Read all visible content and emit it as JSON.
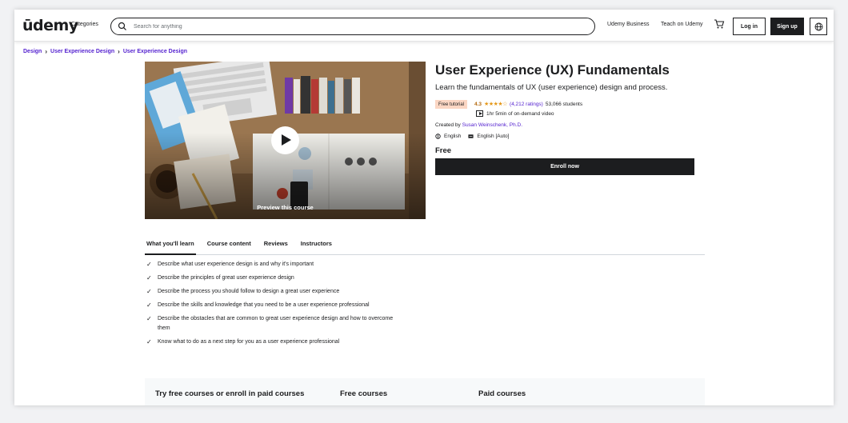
{
  "header": {
    "logo": "ūdemy",
    "categories_label": "Categories",
    "search_placeholder": "Search for anything",
    "business_label": "Udemy Business",
    "teach_label": "Teach on Udemy",
    "login_label": "Log in",
    "signup_label": "Sign up",
    "icons": {
      "search": "search-icon",
      "cart": "cart-icon",
      "language": "globe-icon"
    }
  },
  "breadcrumb": [
    "Design",
    "User Experience Design",
    "User Experience Design"
  ],
  "preview": {
    "label": "Preview this course"
  },
  "course": {
    "title": "User Experience (UX) Fundamentals",
    "subtitle": "Learn the fundamentals of UX (user experience) design and process.",
    "badge": "Free tutorial",
    "rating": "4.3",
    "stars": "★★★★☆",
    "ratings_count": "(4,212 ratings)",
    "students": "53,066 students",
    "video_length": "1hr 5min of on-demand video",
    "created_by_label": "Created by",
    "author": "Susan Weinschenk, Ph.D.",
    "language": "English",
    "captions": "English [Auto]",
    "price": "Free",
    "enroll_label": "Enroll now"
  },
  "tabs": [
    {
      "label": "What you'll learn",
      "active": true
    },
    {
      "label": "Course content",
      "active": false
    },
    {
      "label": "Reviews",
      "active": false
    },
    {
      "label": "Instructors",
      "active": false
    }
  ],
  "learn_items": [
    "Describe what user experience design is and why it's important",
    "Describe the principles of great user experience design",
    "Describe the process you should follow to design a great user experience",
    "Describe the skills and knowledge that you need to be a user experience professional",
    "Describe the obstacles that are common to great user experience design and how to overcome them",
    "Know what to do as a next step for you as a user experience professional"
  ],
  "bottom": {
    "heading_1": "Try free courses or enroll in paid courses",
    "heading_2": "Free courses",
    "heading_3": "Paid courses"
  },
  "colors": {
    "accent": "#a435f0",
    "link": "#5624d0",
    "dark": "#1c1d1f",
    "star": "#e59819"
  }
}
